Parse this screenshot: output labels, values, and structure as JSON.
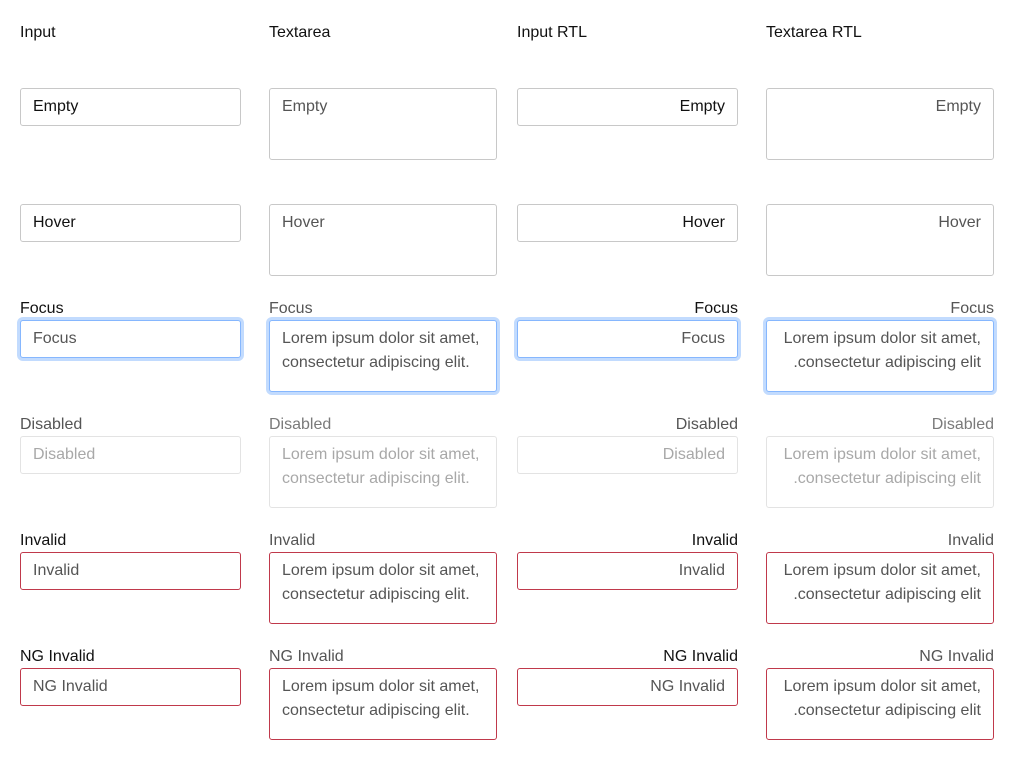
{
  "headers": {
    "input": "Input",
    "textarea": "Textarea",
    "input_rtl": "Input RTL",
    "textarea_rtl": "Textarea RTL"
  },
  "rows": {
    "empty": {
      "label": "",
      "input_value": "Empty",
      "textarea_placeholder": "Empty"
    },
    "hover": {
      "label": "",
      "input_value": "Hover",
      "textarea_placeholder": "Hover"
    },
    "focus": {
      "label": "Focus",
      "input_value": "Focus",
      "textarea_value": "Lorem ipsum dolor sit amet, consectetur adipiscing elit."
    },
    "disabled": {
      "label": "Disabled",
      "input_value": "Disabled",
      "textarea_value": "Lorem ipsum dolor sit amet, consectetur adipiscing elit."
    },
    "invalid": {
      "label": "Invalid",
      "input_value": "Invalid",
      "textarea_value": "Lorem ipsum dolor sit amet, consectetur adipiscing elit."
    },
    "ng_invalid": {
      "label": "NG Invalid",
      "input_value": "NG Invalid",
      "textarea_value": "Lorem ipsum dolor sit amet, consectetur adipiscing elit."
    }
  },
  "colors": {
    "focus_border": "#86b7fe",
    "invalid_border": "#c0394b",
    "default_border": "#c8c8c8",
    "disabled_border": "#e3e3e3"
  }
}
